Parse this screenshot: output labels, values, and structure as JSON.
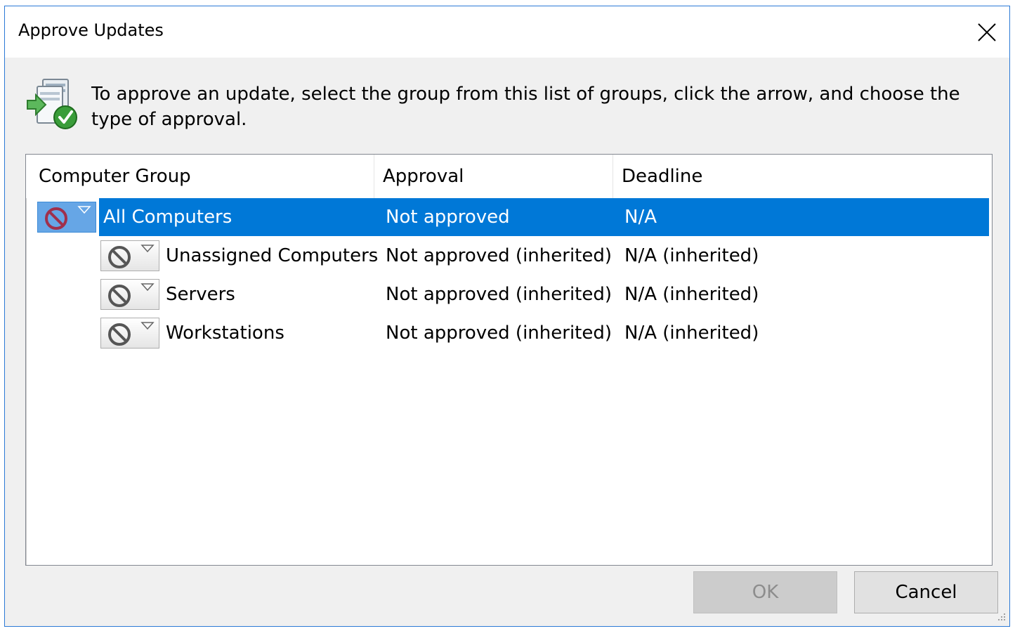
{
  "window": {
    "title": "Approve Updates",
    "close_glyph": "✕"
  },
  "instruction": {
    "text": "To approve an update, select the group from this list of groups, click the arrow, and choose the type of approval.",
    "icon": "approve-update-icon"
  },
  "grid": {
    "columns": [
      "Computer Group",
      "Approval",
      "Deadline"
    ],
    "rows": [
      {
        "group": "All Computers",
        "approval": "Not approved",
        "deadline": "N/A",
        "selected": true,
        "indent_level": 0
      },
      {
        "group": "Unassigned Computers",
        "approval": "Not approved (inherited)",
        "deadline": "N/A (inherited)",
        "selected": false,
        "indent_level": 1
      },
      {
        "group": "Servers",
        "approval": "Not approved (inherited)",
        "deadline": "N/A (inherited)",
        "selected": false,
        "indent_level": 1
      },
      {
        "group": "Workstations",
        "approval": "Not approved (inherited)",
        "deadline": "N/A (inherited)",
        "selected": false,
        "indent_level": 1
      }
    ]
  },
  "buttons": {
    "ok": "OK",
    "cancel": "Cancel",
    "ok_enabled": false
  },
  "colors": {
    "selection": "#0078d7",
    "window_border": "#2b79d6",
    "noentry_selected": "#a0304c",
    "noentry_normal": "#555555"
  }
}
